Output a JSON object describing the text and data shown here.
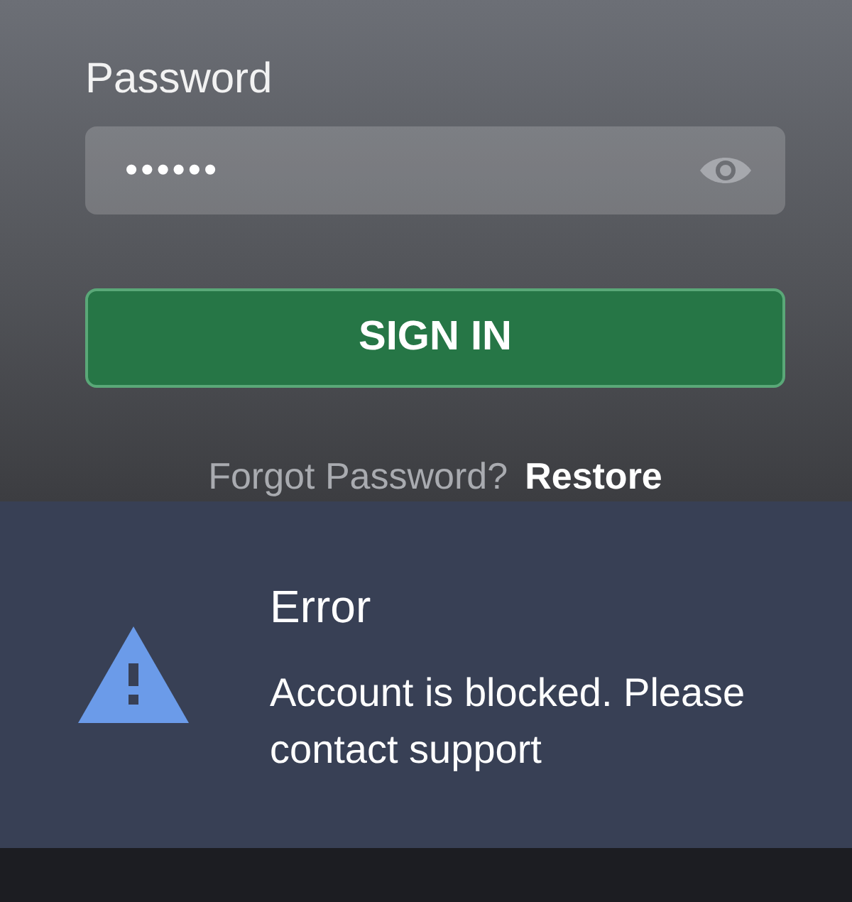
{
  "form": {
    "password_label": "Password",
    "password_value": "••••••",
    "sign_in_button": "SIGN IN",
    "forgot_text": "Forgot Password?",
    "restore_link": "Restore"
  },
  "error": {
    "title": "Error",
    "message": "Account is blocked. Please contact support"
  }
}
